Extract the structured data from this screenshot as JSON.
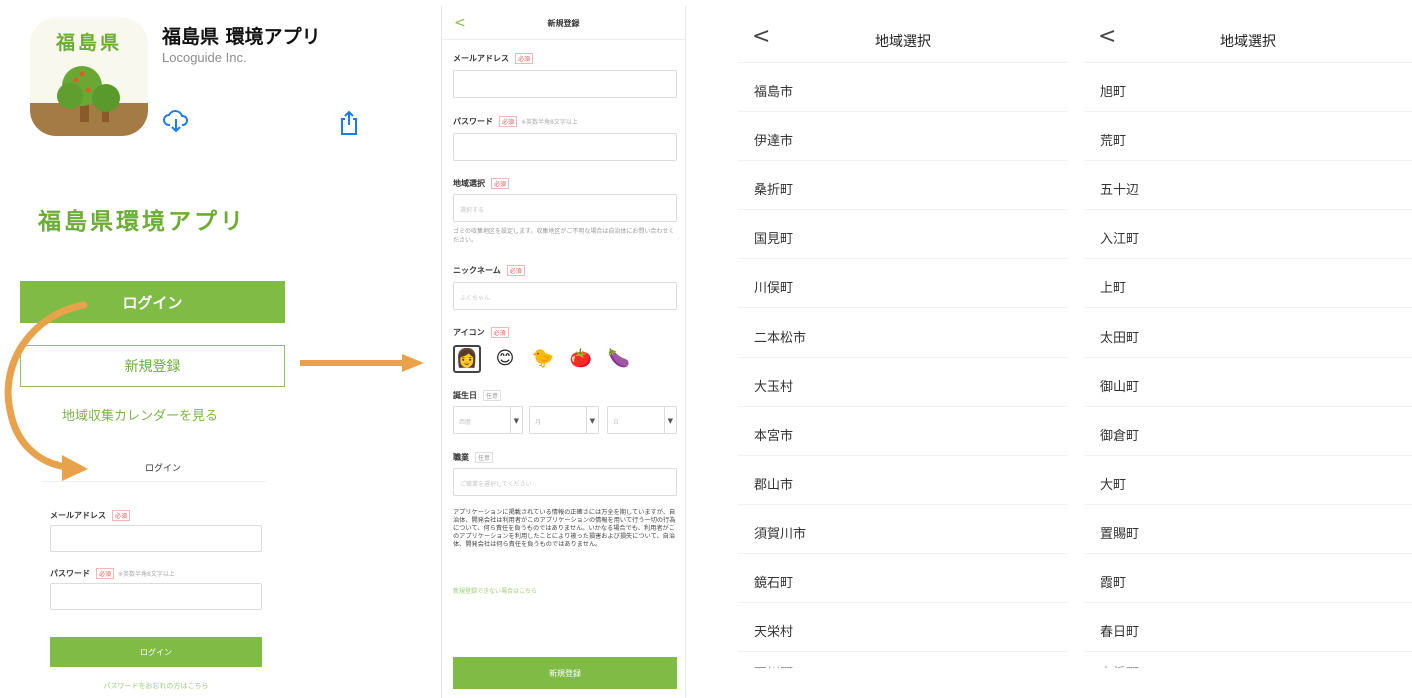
{
  "appstore": {
    "icon_text": "福島県",
    "app_name": "福島県 環境アプリ",
    "developer": "Locoguide Inc."
  },
  "landing": {
    "title": "福島県環境アプリ",
    "login_button": "ログイン",
    "register_button": "新規登録",
    "calendar_link": "地域収集カレンダーを見る"
  },
  "login_form": {
    "back": "<",
    "title": "ログイン",
    "email_label": "メールアドレス",
    "email_required": "必須",
    "password_label": "パスワード",
    "password_required": "必須",
    "password_note": "※英数半角8文字以上",
    "submit_button": "ログイン",
    "forgot_link": "パスワードをお忘れの方はこちら"
  },
  "register_form": {
    "back": "<",
    "title": "新規登録",
    "email_label": "メールアドレス",
    "password_label": "パスワード",
    "password_note": "※英数半角8文字以上",
    "area_label": "地域選択",
    "area_placeholder": "選択する",
    "area_help": "ゴミの収集地区を設定します。収集地区がご不明な場合は自治体にお問い合わせください。",
    "nickname_label": "ニックネーム",
    "nickname_placeholder": "ふくちゃん",
    "icon_label": "アイコン",
    "icons": [
      "👩",
      "😊",
      "🐤",
      "🍅",
      "🍆"
    ],
    "birthday_label": "誕生日",
    "optional_tag": "任意",
    "required_tag": "必須",
    "birthday_year": "西暦",
    "birthday_month": "月",
    "birthday_day": "日",
    "job_label": "職業",
    "job_placeholder": "ご職業を選択してください",
    "disclaimer": "アプリケーションに掲載されている情報の正確さには万全を期していますが、自治体、開発会社は利用者がこのアプリケーションの情報を用いて行う一切の行為について、何ら責任を負うものではありません。いかなる場合でも、利用者がこのアプリケーションを利用したことにより被った損害および損失について、自治体、開発会社は何ら責任を負うものではありません。",
    "help_link": "新規登録できない場合はこちら",
    "submit_button": "新規登録"
  },
  "region_list_1": {
    "back": "<",
    "title": "地域選択",
    "items": [
      "福島市",
      "伊達市",
      "桑折町",
      "国見町",
      "川俣町",
      "二本松市",
      "大玉村",
      "本宮市",
      "郡山市",
      "須賀川市",
      "鏡石町",
      "天栄村",
      "石川町"
    ]
  },
  "region_list_2": {
    "back": "<",
    "title": "地域選択",
    "items": [
      "旭町",
      "荒町",
      "五十辺",
      "入江町",
      "上町",
      "太田町",
      "御山町",
      "御倉町",
      "大町",
      "置賜町",
      "霞町",
      "春日町",
      "上浜町"
    ]
  },
  "colors": {
    "accent_green": "#7fbb45",
    "arrow_orange": "#e9a24c"
  }
}
